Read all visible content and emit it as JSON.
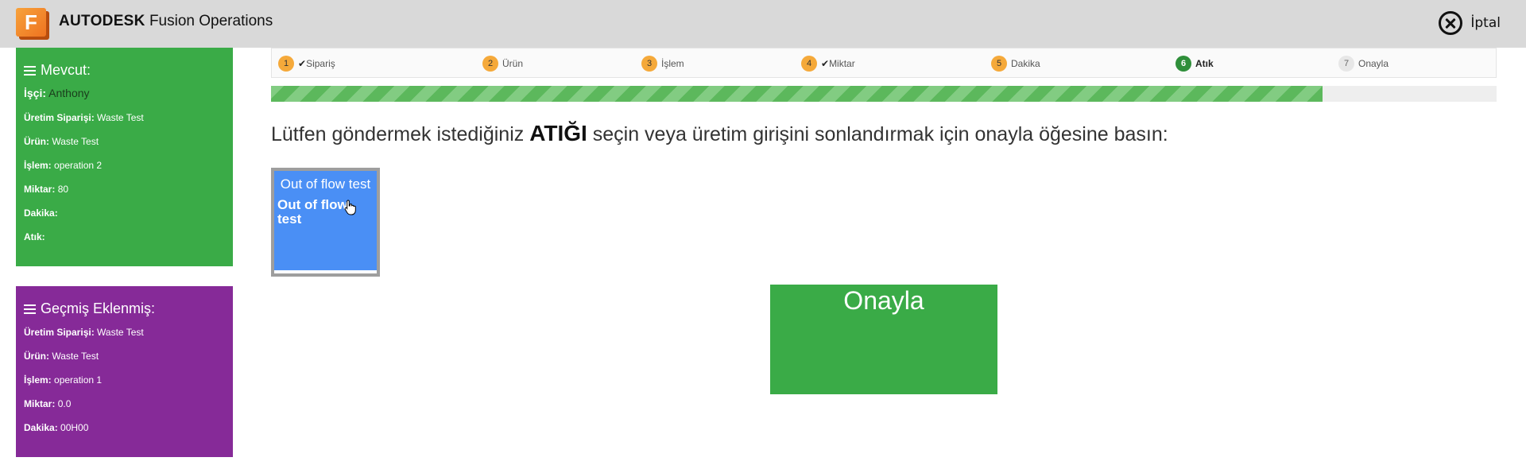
{
  "header": {
    "logo_letter": "F",
    "brand_strong": "AUTODESK",
    "brand_rest": "Fusion Operations",
    "cancel_label": "İptal"
  },
  "current": {
    "title": "Mevcut:",
    "worker_label": "İşçi:",
    "worker_value": "Anthony",
    "rows": [
      {
        "label": "Üretim Siparişi:",
        "value": "Waste Test"
      },
      {
        "label": "Ürün:",
        "value": "Waste Test"
      },
      {
        "label": "İşlem:",
        "value": "operation 2"
      },
      {
        "label": "Miktar:",
        "value": "80"
      },
      {
        "label": "Dakika:",
        "value": ""
      },
      {
        "label": "Atık:",
        "value": ""
      }
    ]
  },
  "history": {
    "title": "Geçmiş Eklenmiş:",
    "rows": [
      {
        "label": "Üretim Siparişi:",
        "value": "Waste Test"
      },
      {
        "label": "Ürün:",
        "value": "Waste Test"
      },
      {
        "label": "İşlem:",
        "value": "operation 1"
      },
      {
        "label": "Miktar:",
        "value": "0.0"
      },
      {
        "label": "Dakika:",
        "value": "00H00"
      }
    ]
  },
  "steps": [
    {
      "num": "1",
      "label": "Sipariş",
      "state": "done",
      "checked": true
    },
    {
      "num": "2",
      "label": "Ürün",
      "state": "done",
      "checked": false
    },
    {
      "num": "3",
      "label": "İşlem",
      "state": "done",
      "checked": false
    },
    {
      "num": "4",
      "label": "Miktar",
      "state": "done",
      "checked": true
    },
    {
      "num": "5",
      "label": "Dakika",
      "state": "done",
      "checked": false
    },
    {
      "num": "6",
      "label": "Atık",
      "state": "active",
      "checked": false
    },
    {
      "num": "7",
      "label": "Onayla",
      "state": "todo",
      "checked": false
    }
  ],
  "progress_fraction": 0.858,
  "instruction": {
    "before": "Lütfen göndermek istediğiniz ",
    "emphasis": "ATIĞI",
    "after": " seçin veya üretim girişini sonlandırmak için onayla öğesine basın:"
  },
  "waste_item": {
    "title": "Out of flow test",
    "subtitle": "Out of flow test"
  },
  "confirm_label": "Onayla"
}
